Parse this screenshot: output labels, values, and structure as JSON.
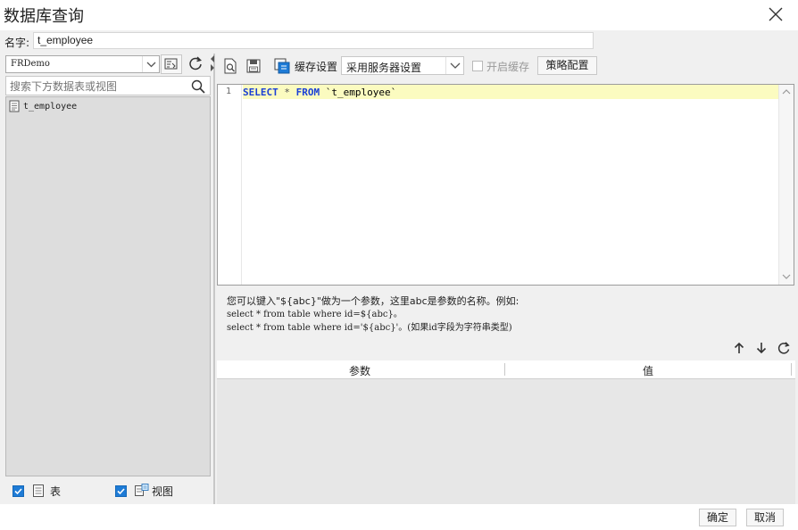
{
  "window": {
    "title": "数据库查询",
    "close_icon": "close-icon"
  },
  "name_row": {
    "label": "名字:",
    "value": "t_employee"
  },
  "left": {
    "datasource": "FRDemo",
    "search_placeholder": "搜索下方数据表或视图",
    "tables": [
      {
        "label": "t_employee",
        "icon": "table-icon"
      }
    ],
    "footer": {
      "tables_label": "表",
      "views_label": "视图",
      "tables_checked": true,
      "views_checked": true
    }
  },
  "toolbar": {
    "cache_label": "缓存设置",
    "cache_value": "采用服务器设置",
    "open_cache_label": "开启缓存",
    "strategy_button": "策略配置"
  },
  "editor": {
    "line_number": "1",
    "tokens": {
      "select": "SELECT",
      "star": " * ",
      "from": "FROM",
      "table": " `t_employee`"
    }
  },
  "hint": {
    "line1": "您可以键入\"${abc}\"做为一个参数，这里abc是参数的名称。例如:",
    "line2": "select * from table where id=${abc}。",
    "line3": "select * from table where id='${abc}'。(如果id字段为字符串类型)"
  },
  "params": {
    "col_param": "参数",
    "col_value": "值"
  },
  "buttons": {
    "ok": "确定",
    "cancel": "取消"
  },
  "colors": {
    "accent": "#1e7bd6",
    "keyword": "#1a3fd6",
    "highlight_line": "#fbfbc0"
  }
}
